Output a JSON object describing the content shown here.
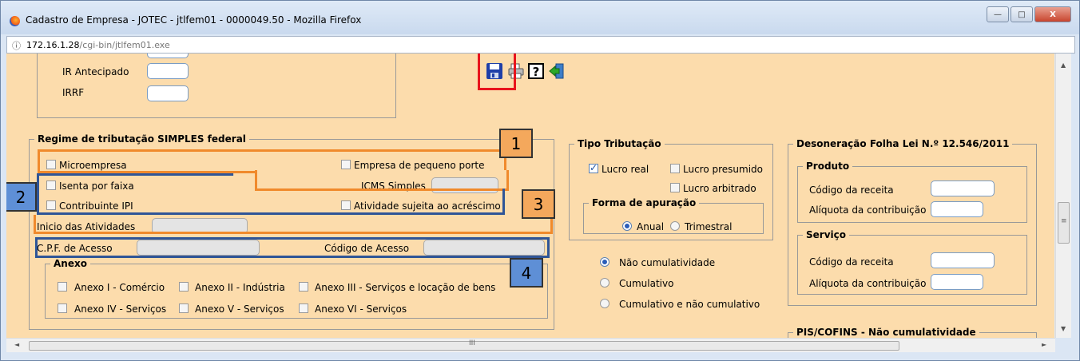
{
  "window": {
    "title": "Cadastro de Empresa - JOTEC - jtlfem01 - 0000049.50 - Mozilla Firefox",
    "minimize": "—",
    "maximize": "□",
    "close": "X"
  },
  "address": {
    "host": "172.16.1.28",
    "path": "/cgi-bin/jtlfem01.exe",
    "info_icon": "ⓘ"
  },
  "toolbar": {
    "icons": [
      "save-icon",
      "print-icon",
      "help-icon",
      "exit-icon"
    ]
  },
  "ir_section": {
    "ir_antecipado_label": "IR Antecipado",
    "ir_antecipado_value": "",
    "irrf_label": "IRRF",
    "irrf_value": ""
  },
  "simples": {
    "legend": "Regime de tributação SIMPLES federal",
    "microempresa": "Microempresa",
    "empresa_pequeno_porte": "Empresa de pequeno porte",
    "isenta_faixa": "Isenta por faixa",
    "icms_simples_label": "ICMS Simples",
    "contribuinte_ipi": "Contribuinte IPI",
    "atividade_acrescimo": "Atividade sujeita ao acréscimo",
    "inicio_atividades_label": "Inicio das Atividades",
    "cpf_acesso_label": "C.P.F. de Acesso",
    "codigo_acesso_label": "Código de Acesso"
  },
  "anexo": {
    "legend": "Anexo",
    "items": [
      "Anexo I - Comércio",
      "Anexo II - Indústria",
      "Anexo III - Serviços e locação de bens",
      "Anexo IV - Serviços",
      "Anexo V - Serviços",
      "Anexo VI - Serviços"
    ]
  },
  "tipo_tributacao": {
    "legend": "Tipo Tributação",
    "lucro_real": "Lucro real",
    "lucro_real_checked": true,
    "lucro_presumido": "Lucro presumido",
    "lucro_arbitrado": "Lucro arbitrado",
    "forma_apuracao_legend": "Forma de apuração",
    "anual": "Anual",
    "trimestral": "Trimestral",
    "forma_selected": "Anual"
  },
  "cumulatividade": {
    "options": [
      "Não cumulatividade",
      "Cumulativo",
      "Cumulativo e não cumulativo"
    ],
    "selected": "Não cumulatividade"
  },
  "desoneracao": {
    "legend": "Desoneração Folha Lei N.º 12.546/2011",
    "produto_legend": "Produto",
    "produto_codigo_label": "Código da receita",
    "produto_aliquota_label": "Alíquota da contribuição",
    "servico_legend": "Serviço",
    "servico_codigo_label": "Código da receita",
    "servico_aliquota_label": "Alíquota da contribuição",
    "pis_cofins_legend": "PIS/COFINS - Não cumulatividade"
  },
  "callouts": [
    "1",
    "2",
    "3",
    "4"
  ],
  "scroll": {
    "up": "▲",
    "down": "▼",
    "left": "◄",
    "right": "►",
    "grip": "III",
    "vgrip": "≡"
  },
  "colors": {
    "background": "#fcdcac",
    "highlight_orange": "#f08a2c",
    "highlight_blue": "#2f5597",
    "highlight_red": "#e8141c"
  }
}
